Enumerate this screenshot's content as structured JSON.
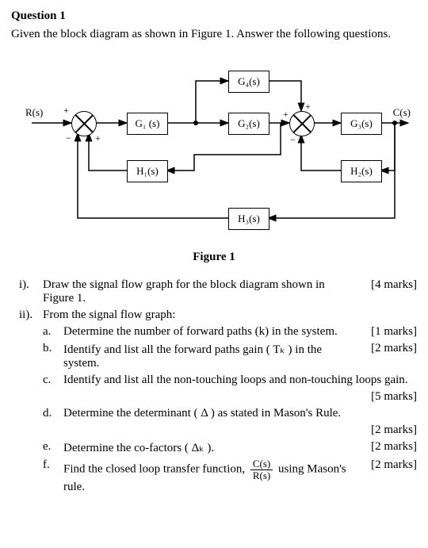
{
  "header": {
    "title": "Question 1"
  },
  "prompt": "Given the block diagram as shown in Figure 1. Answer the following questions.",
  "diagram": {
    "input_label": "R(s)",
    "output_label": "C(s)",
    "blocks": {
      "G1": "G₁ (s)",
      "G2": "G₂(s)",
      "G3": "G₃(s)",
      "G4": "G₄(s)",
      "H1": "H₁(s)",
      "H2": "H₂(s)",
      "H3": "H₃(s)"
    },
    "signs": {
      "s1_top": "+",
      "s1_botL": "−",
      "s1_botR": "+",
      "s2_top": "+",
      "s2_right": "+",
      "s2_bot": "−"
    },
    "figure_caption": "Figure 1"
  },
  "questions": {
    "i": {
      "num": "i).",
      "text": "Draw the signal flow graph for the block diagram shown in Figure 1.",
      "marks": "[4 marks]"
    },
    "ii": {
      "num": "ii).",
      "text": "From the signal flow graph:"
    },
    "a": {
      "num": "a.",
      "text": "Determine the number of forward paths (k) in the system.",
      "marks": "[1 marks]"
    },
    "b": {
      "num": "b.",
      "text": "Identify and list all the forward paths gain ( Tₖ ) in the system.",
      "marks": "[2 marks]"
    },
    "c": {
      "num": "c.",
      "text": "Identify and list all the non-touching loops and non-touching loops gain.",
      "marks": "[5 marks]"
    },
    "d": {
      "num": "d.",
      "text": "Determine the determinant ( Δ ) as stated in Mason's Rule.",
      "marks": "[2 marks]"
    },
    "e": {
      "num": "e.",
      "text": "Determine the co-factors ( Δₖ ).",
      "marks": "[2 marks]"
    },
    "f": {
      "num": "f.",
      "pre": "Find the closed loop transfer function, ",
      "frac_top": "C(s)",
      "frac_bot": "R(s)",
      "post": " using Mason's rule.",
      "marks": "[2 marks]"
    }
  }
}
